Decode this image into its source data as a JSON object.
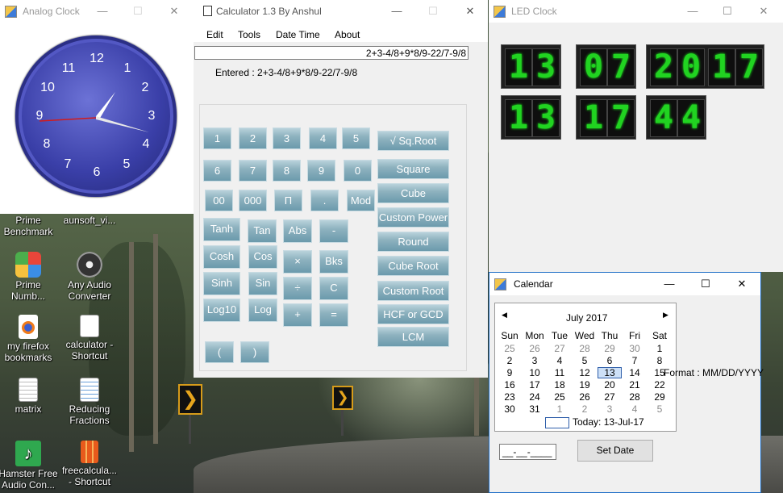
{
  "desktop": {
    "icons": [
      {
        "label1": "Prime",
        "label2": "Benchmark"
      },
      {
        "label1": "aunsoft_vi...",
        "label2": ""
      },
      {
        "label1": "Prime",
        "label2": "Numb..."
      },
      {
        "label1": "Any Audio",
        "label2": "Converter"
      },
      {
        "label1": "my firefox",
        "label2": "bookmarks"
      },
      {
        "label1": "calculator -",
        "label2": "Shortcut"
      },
      {
        "label1": "matrix",
        "label2": ""
      },
      {
        "label1": "Reducing",
        "label2": "Fractions"
      },
      {
        "label1": "Hamster Free",
        "label2": "Audio Con..."
      },
      {
        "label1": "freecalcula...",
        "label2": "- Shortcut"
      }
    ]
  },
  "analog_clock": {
    "title": "Analog Clock",
    "numbers": [
      "12",
      "1",
      "2",
      "3",
      "4",
      "5",
      "6",
      "7",
      "8",
      "9",
      "10",
      "11"
    ]
  },
  "calculator": {
    "title": "Calculator 1.3 By Anshul",
    "menu": [
      "Edit",
      "Tools",
      "Date Time",
      "About"
    ],
    "expression": "2+3-4/8+9*8/9-22/7-9/8",
    "entered": "Entered : 2+3-4/8+9*8/9-22/7-9/8",
    "buttons": {
      "b1": "1",
      "b2": "2",
      "b3": "3",
      "b4": "4",
      "b5": "5",
      "b6": "6",
      "b7": "7",
      "b8": "8",
      "b9": "9",
      "b0": "0",
      "b00": "00",
      "b000": "000",
      "pi": "Π",
      "dot": ".",
      "mod": "Mod",
      "tanh": "Tanh",
      "tan": "Tan",
      "abs": "Abs",
      "minus": "-",
      "cosh": "Cosh",
      "cos": "Cos",
      "times": "×",
      "bks": "Bks",
      "sinh": "Sinh",
      "sin": "Sin",
      "div": "÷",
      "clear": "C",
      "log10": "Log10",
      "log": "Log",
      "plus": "+",
      "equals": "=",
      "lparen": "(",
      "rparen": ")",
      "sqroot": "√ Sq.Root",
      "square": "Square",
      "cube": "Cube",
      "custompower": "Custom Power",
      "round": "Round",
      "cuberoot": "Cube Root",
      "customroot": "Custom Root",
      "hcf": "HCF or GCD",
      "lcm": "LCM"
    }
  },
  "led_clock": {
    "title": "LED Clock",
    "date_digits": [
      "1",
      "3",
      "0",
      "7",
      "2",
      "0",
      "1",
      "7"
    ],
    "time_digits": [
      "1",
      "3",
      "1",
      "7",
      "4",
      "4"
    ],
    "digit_color": "#21d321"
  },
  "calendar": {
    "title": "Calendar",
    "month_label": "July 2017",
    "weekdays": [
      "Sun",
      "Mon",
      "Tue",
      "Wed",
      "Thu",
      "Fri",
      "Sat"
    ],
    "weeks": [
      [
        "25",
        "26",
        "27",
        "28",
        "29",
        "30",
        "1"
      ],
      [
        "2",
        "3",
        "4",
        "5",
        "6",
        "7",
        "8"
      ],
      [
        "9",
        "10",
        "11",
        "12",
        "13",
        "14",
        "15"
      ],
      [
        "16",
        "17",
        "18",
        "19",
        "20",
        "21",
        "22"
      ],
      [
        "23",
        "24",
        "25",
        "26",
        "27",
        "28",
        "29"
      ],
      [
        "30",
        "31",
        "1",
        "2",
        "3",
        "4",
        "5"
      ]
    ],
    "selected_day": "13",
    "today_text": "Today: 13-Jul-17",
    "format_text": "Format : MM/DD/YYYY",
    "masked_input": "__-__-____",
    "set_date_label": "Set Date"
  },
  "window_controls": {
    "minimize": "—",
    "maximize": "☐",
    "close": "✕"
  }
}
